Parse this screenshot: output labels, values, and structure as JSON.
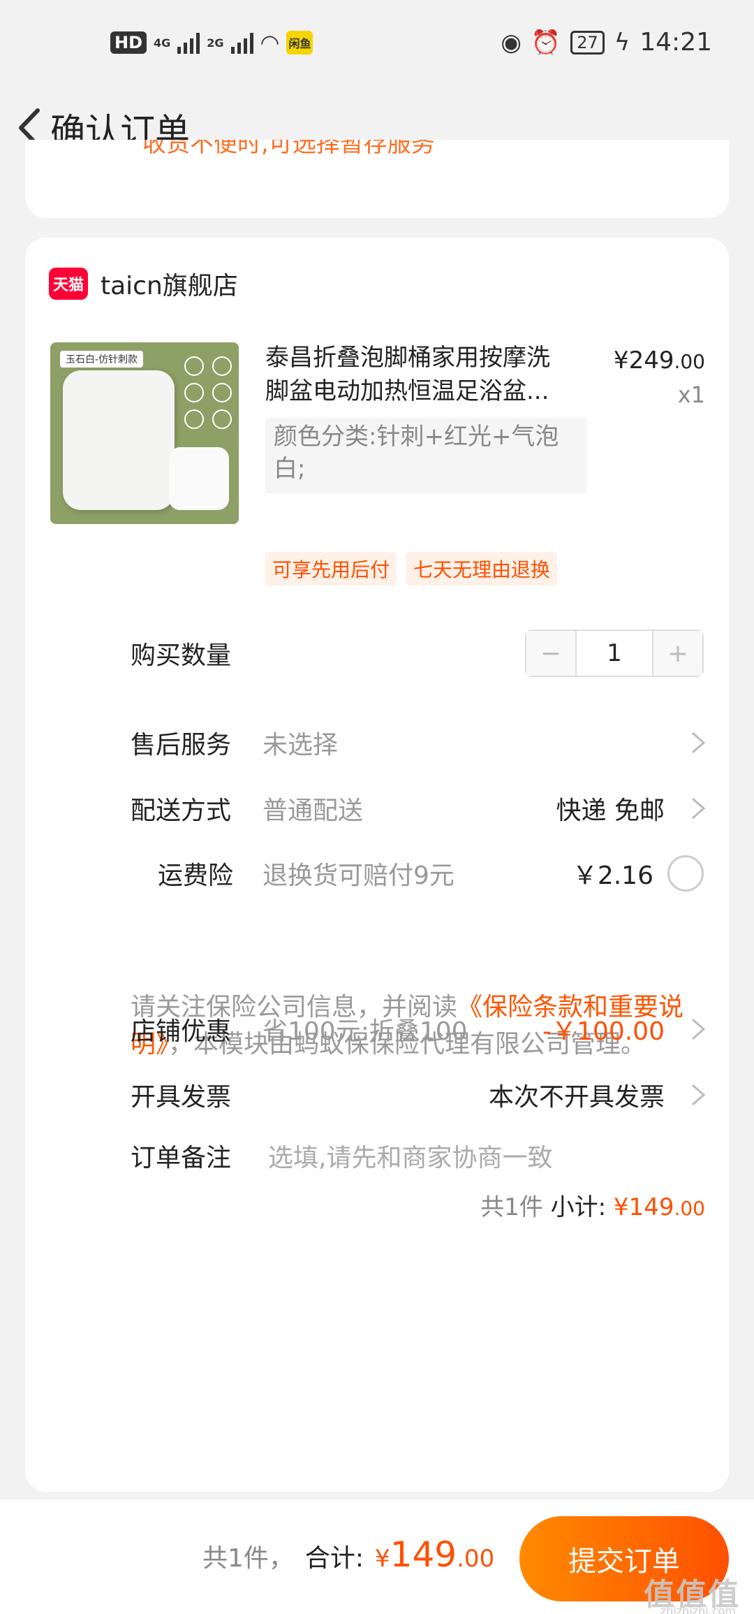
{
  "status_bar": {
    "hd": "HD",
    "net1": "4G",
    "net2": "2G",
    "app_badge": "闲鱼",
    "battery": "27",
    "time": "14:21"
  },
  "nav": {
    "title": "确认订单"
  },
  "top_card": {
    "text": "收货不便时,可选择暂存服务"
  },
  "shop": {
    "platform": "天猫",
    "name": "taicn旗舰店"
  },
  "product": {
    "image_tag": "玉石白-仿针刺款",
    "title": "泰昌折叠泡脚桶家用按摩洗脚盆电动加热恒温足浴盆...",
    "spec": "颜色分类:针刺+红光+气泡白;",
    "price_symbol": "¥",
    "price_int": "249",
    "price_dec": ".00",
    "qty": "x1",
    "badges": [
      "可享先用后付",
      "七天无理由退换"
    ]
  },
  "rows": {
    "quantity": {
      "label": "购买数量",
      "minus": "−",
      "value": "1",
      "plus": "+"
    },
    "after_sales": {
      "label": "售后服务",
      "value": "未选择"
    },
    "delivery": {
      "label": "配送方式",
      "value": "普通配送",
      "right": "快递 免邮"
    },
    "shipping_insurance": {
      "label": "运费险",
      "value": "退换货可赔付9元",
      "right": "￥2.16"
    },
    "shop_discount": {
      "label": "店铺优惠",
      "value": "省100元:折叠100",
      "right": "-￥100.00"
    },
    "invoice": {
      "label": "开具发票",
      "right": "本次不开具发票"
    },
    "note": {
      "label": "订单备注",
      "placeholder": "选填,请先和商家协商一致"
    }
  },
  "notice": {
    "before": "请关注保险公司信息，并阅读",
    "link": "《保险条款和重要说明》",
    "after": "，本模块由蚂蚁保保险代理有限公司管理。"
  },
  "subtotal": {
    "count": "共1件",
    "label": "小计:",
    "symbol": "¥",
    "int": "149",
    "dec": ".00"
  },
  "bottom": {
    "count": "共1件，",
    "label": "合计:",
    "symbol": "¥",
    "int": "149",
    "dec": ".00",
    "submit": "提交订单",
    "watermark": "值值值",
    "watermark_sub": "zhizhizhi.com"
  },
  "colors": {
    "accent": "#ff5000",
    "tmall": "#ff0036",
    "background": "#f2f2f2"
  }
}
